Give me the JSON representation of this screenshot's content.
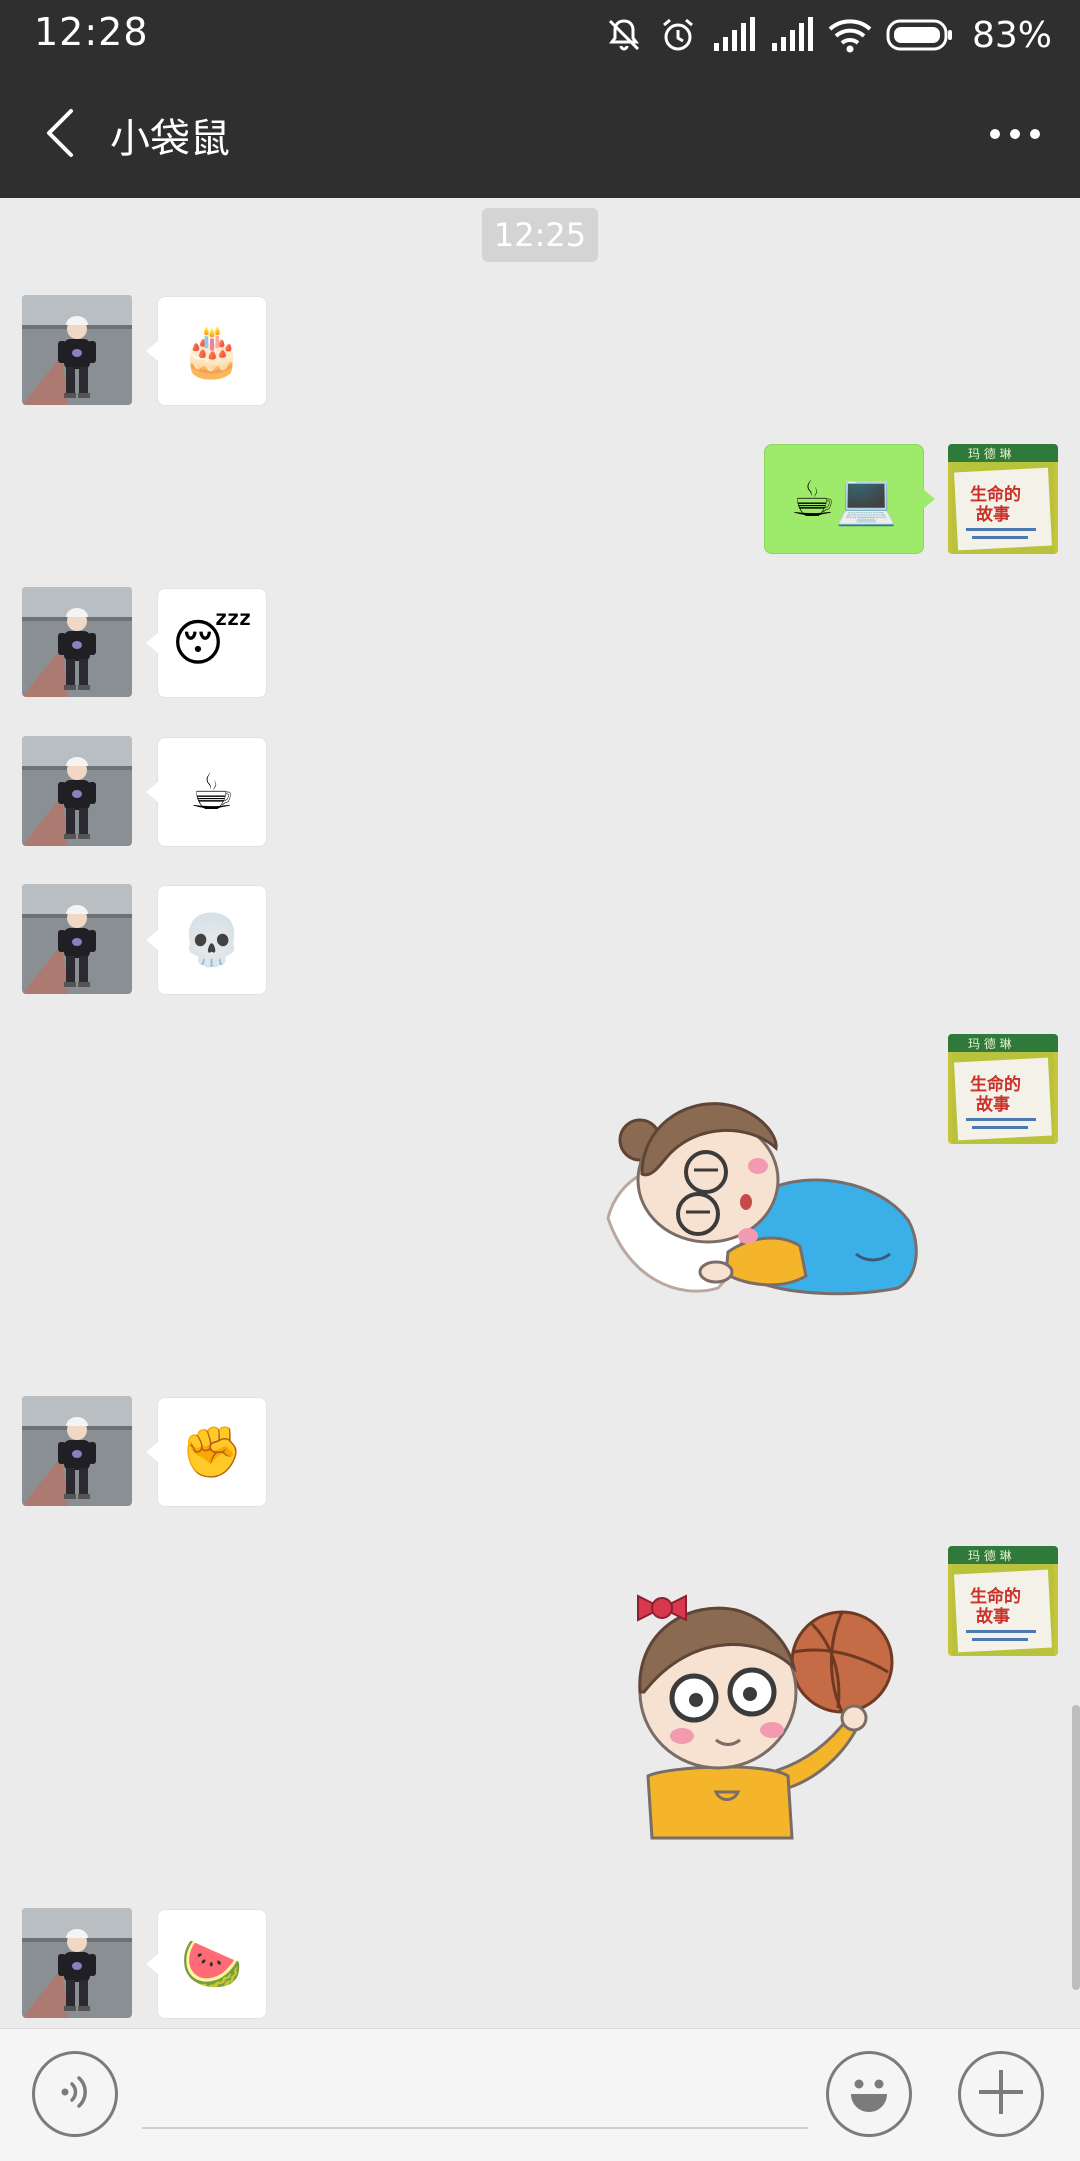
{
  "status_bar": {
    "time": "12:28",
    "battery": "83%",
    "icons": [
      "mute-icon",
      "alarm-icon",
      "signal-icon",
      "signal-icon",
      "wifi-icon",
      "battery-icon"
    ]
  },
  "header": {
    "title": "小袋鼠",
    "back_icon": "chevron-left-icon",
    "more_icon": "more-dots-icon"
  },
  "chat": {
    "timestamp": "12:25",
    "messages": [
      {
        "side": "left",
        "type": "emoji",
        "content": "🎂",
        "icon": "birthday-cake-emoji"
      },
      {
        "side": "right",
        "type": "emoji",
        "content": "☕💻",
        "icon": "coffee-laptop-emoji"
      },
      {
        "side": "left",
        "type": "emoji",
        "content": "😴",
        "icon": "sleepy-face-emoji"
      },
      {
        "side": "left",
        "type": "emoji",
        "content": "☕",
        "icon": "coffee-emoji"
      },
      {
        "side": "left",
        "type": "emoji",
        "content": "💀",
        "icon": "skull-emoji"
      },
      {
        "side": "right",
        "type": "sticker",
        "icon": "sleeping-girl-sticker"
      },
      {
        "side": "left",
        "type": "emoji",
        "content": "✊",
        "icon": "fist-emoji"
      },
      {
        "side": "right",
        "type": "sticker",
        "icon": "girl-basketball-sticker"
      },
      {
        "side": "left",
        "type": "emoji",
        "content": "🍉",
        "icon": "watermelon-emoji"
      }
    ]
  },
  "input_bar": {
    "voice_icon": "voice-icon",
    "input_value": "",
    "emoji_icon": "smiley-icon",
    "plus_icon": "plus-icon"
  },
  "colors": {
    "header_bg": "#2f2f2f",
    "chat_bg": "#ebebeb",
    "sent_bubble": "#9eea6a",
    "received_bubble": "#ffffff"
  }
}
